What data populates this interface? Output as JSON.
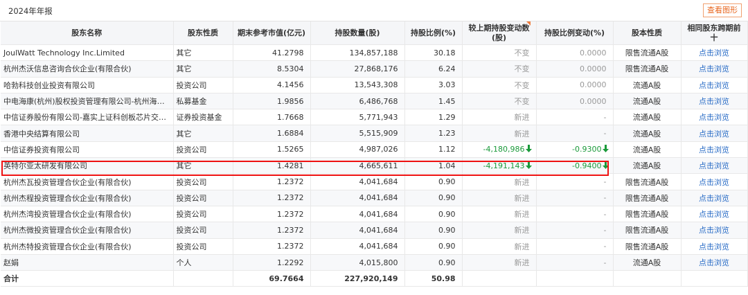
{
  "header": {
    "title": "2024年年报",
    "chart_button": "查看图形"
  },
  "columns": [
    "股东名称",
    "股东性质",
    "期末参考市值(亿元)",
    "持股数量(股)",
    "持股比例(%)",
    "较上期持股变动数(股)",
    "持股比例变动(%)",
    "股本性质",
    "相同股东跨期前十"
  ],
  "rows": [
    {
      "name": "JoulWatt Technology Inc.Limited",
      "type": "其它",
      "value": "41.2798",
      "shares": "134,857,188",
      "ratio": "30.18",
      "change": "不变",
      "ratio_change": "0.0000",
      "share_type": "限售流通A股",
      "link": "点击浏览"
    },
    {
      "name": "杭州杰沃信息咨询合伙企业(有限合伙)",
      "type": "其它",
      "value": "8.5304",
      "shares": "27,868,176",
      "ratio": "6.24",
      "change": "不变",
      "ratio_change": "0.0000",
      "share_type": "限售流通A股",
      "link": "点击浏览"
    },
    {
      "name": "哈勃科技创业投资有限公司",
      "type": "投资公司",
      "value": "4.1456",
      "shares": "13,543,308",
      "ratio": "3.03",
      "change": "不变",
      "ratio_change": "0.0000",
      "share_type": "流通A股",
      "link": "点击浏览"
    },
    {
      "name": "中电海康(杭州)股权投资管理有限公司-杭州海康智…",
      "type": "私募基金",
      "value": "1.9856",
      "shares": "6,486,768",
      "ratio": "1.45",
      "change": "不变",
      "ratio_change": "0.0000",
      "share_type": "流通A股",
      "link": "点击浏览"
    },
    {
      "name": "中信证券股份有限公司-嘉实上证科创板芯片交易型…",
      "type": "证券投资基金",
      "value": "1.7668",
      "shares": "5,771,943",
      "ratio": "1.29",
      "change": "新进",
      "ratio_change": "-",
      "share_type": "流通A股",
      "link": "点击浏览"
    },
    {
      "name": "香港中央结算有限公司",
      "type": "其它",
      "value": "1.6884",
      "shares": "5,515,909",
      "ratio": "1.23",
      "change": "新进",
      "ratio_change": "-",
      "share_type": "流通A股",
      "link": "点击浏览"
    },
    {
      "name": "中信证券投资有限公司",
      "type": "投资公司",
      "value": "1.5265",
      "shares": "4,987,026",
      "ratio": "1.12",
      "change": "-4,180,986",
      "change_down": true,
      "ratio_change": "-0.9300",
      "ratio_down": true,
      "share_type": "流通A股",
      "link": "点击浏览"
    },
    {
      "name": "英特尔亚太研发有限公司",
      "type": "其它",
      "value": "1.4281",
      "shares": "4,665,611",
      "ratio": "1.04",
      "change": "-4,191,143",
      "change_down": true,
      "ratio_change": "-0.9400",
      "ratio_down": true,
      "share_type": "流通A股",
      "link": "点击浏览"
    },
    {
      "name": "杭州杰瓦投资管理合伙企业(有限合伙)",
      "type": "投资公司",
      "value": "1.2372",
      "shares": "4,041,684",
      "ratio": "0.90",
      "change": "新进",
      "ratio_change": "-",
      "share_type": "限售流通A股",
      "link": "点击浏览"
    },
    {
      "name": "杭州杰程投资管理合伙企业(有限合伙)",
      "type": "投资公司",
      "value": "1.2372",
      "shares": "4,041,684",
      "ratio": "0.90",
      "change": "新进",
      "ratio_change": "-",
      "share_type": "限售流通A股",
      "link": "点击浏览"
    },
    {
      "name": "杭州杰湾投资管理合伙企业(有限合伙)",
      "type": "投资公司",
      "value": "1.2372",
      "shares": "4,041,684",
      "ratio": "0.90",
      "change": "新进",
      "ratio_change": "-",
      "share_type": "限售流通A股",
      "link": "点击浏览"
    },
    {
      "name": "杭州杰微投资管理合伙企业(有限合伙)",
      "type": "投资公司",
      "value": "1.2372",
      "shares": "4,041,684",
      "ratio": "0.90",
      "change": "新进",
      "ratio_change": "-",
      "share_type": "限售流通A股",
      "link": "点击浏览"
    },
    {
      "name": "杭州杰特投资管理合伙企业(有限合伙)",
      "type": "投资公司",
      "value": "1.2372",
      "shares": "4,041,684",
      "ratio": "0.90",
      "change": "新进",
      "ratio_change": "-",
      "share_type": "限售流通A股",
      "link": "点击浏览"
    },
    {
      "name": "赵娟",
      "type": "个人",
      "value": "1.2292",
      "shares": "4,015,800",
      "ratio": "0.90",
      "change": "新进",
      "ratio_change": "-",
      "share_type": "流通A股",
      "link": "点击浏览"
    }
  ],
  "total": {
    "label": "合计",
    "value": "69.7664",
    "shares": "227,920,149",
    "ratio": "50.98"
  },
  "colors": {
    "accent": "#e8661e",
    "down": "#1a9a3a",
    "link": "#2a6cc6",
    "highlight": "#e11111"
  },
  "highlighted_row": "英特尔亚太研发有限公司"
}
